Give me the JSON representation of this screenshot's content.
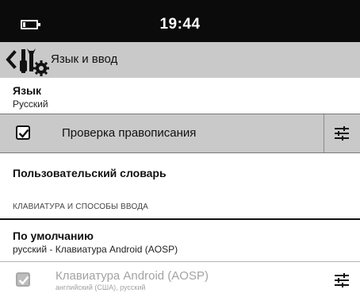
{
  "status_bar": {
    "time": "19:44",
    "battery_icon": "battery-low-icon"
  },
  "action_bar": {
    "back_icon": "chevron-left-icon",
    "app_icon": "settings-tools-icon",
    "title": "Язык и ввод"
  },
  "language": {
    "title": "Язык",
    "summary": "Русский"
  },
  "spell_check": {
    "label": "Проверка правописания",
    "checked": true,
    "settings_icon": "tune-icon"
  },
  "user_dictionary": {
    "title": "Пользовательский словарь"
  },
  "keyboard_section": {
    "header": "КЛАВИАТУРА И СПОСОБЫ ВВОДА"
  },
  "default_input": {
    "title": "По умолчанию",
    "summary": "русский - Клавиатура Android (AOSP)"
  },
  "ime_aosp": {
    "title": "Клавиатура Android (AOSP)",
    "summary": "английский (США), русский",
    "checked": true,
    "enabled": false,
    "settings_icon": "tune-icon"
  },
  "colors": {
    "status_bar_bg": "#0b0b0b",
    "action_bar_bg": "#c9c9c9",
    "highlight_row_bg": "#c9c9c9",
    "disabled_text": "#a3a3a3"
  }
}
